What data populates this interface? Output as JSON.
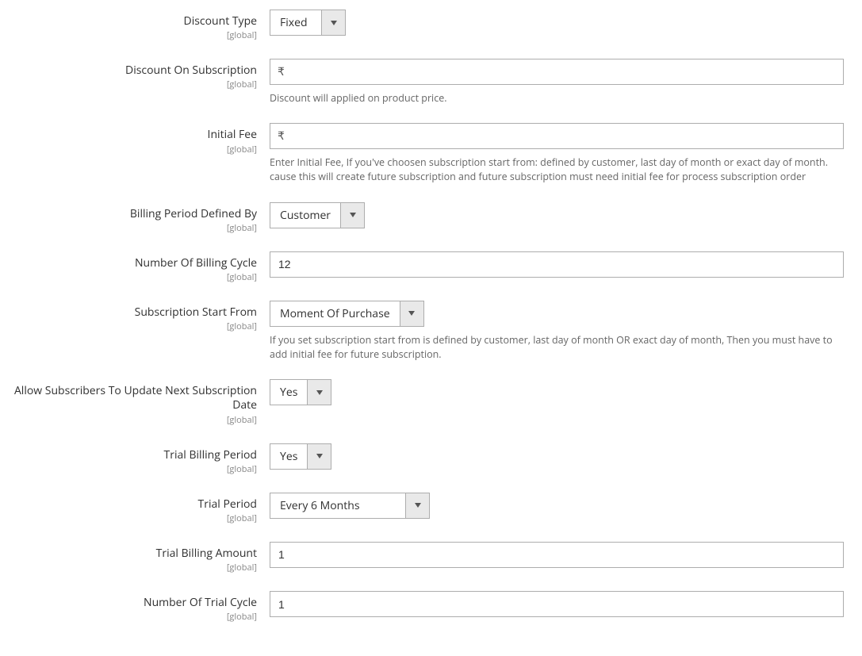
{
  "scopeLabel": "[global]",
  "currencySymbol": "₹",
  "fields": {
    "discountType": {
      "label": "Discount Type",
      "value": "Fixed"
    },
    "discountOnSubscription": {
      "label": "Discount On Subscription",
      "value": "",
      "hint": "Discount will applied on product price."
    },
    "initialFee": {
      "label": "Initial Fee",
      "value": "",
      "hint": "Enter Initial Fee, If you've choosen subscription start from: defined by customer, last day of month or exact day of month. cause this will create future subscription and future subscription must need initial fee for process subscription order"
    },
    "billingPeriodDefinedBy": {
      "label": "Billing Period Defined By",
      "value": "Customer"
    },
    "numberOfBillingCycle": {
      "label": "Number Of Billing Cycle",
      "value": "12"
    },
    "subscriptionStartFrom": {
      "label": "Subscription Start From",
      "value": "Moment Of Purchase",
      "hint": "If you set subscription start from is defined by customer, last day of month OR exact day of month, Then you must have to add initial fee for future subscription."
    },
    "allowUpdateNextDate": {
      "label": "Allow Subscribers To Update Next Subscription Date",
      "value": "Yes"
    },
    "trialBillingPeriod": {
      "label": "Trial Billing Period",
      "value": "Yes"
    },
    "trialPeriod": {
      "label": "Trial Period",
      "value": "Every 6 Months"
    },
    "trialBillingAmount": {
      "label": "Trial Billing Amount",
      "value": "1"
    },
    "numberOfTrialCycle": {
      "label": "Number Of Trial Cycle",
      "value": "1"
    }
  }
}
